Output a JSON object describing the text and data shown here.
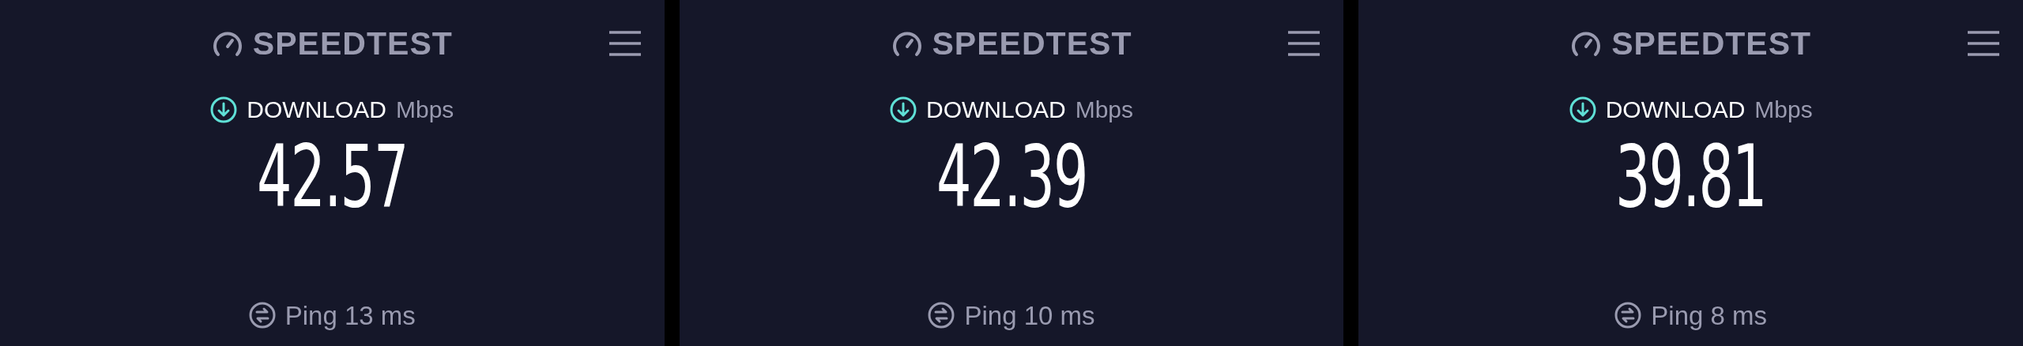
{
  "panels": [
    {
      "logo": "SPEEDTEST",
      "metric": "DOWNLOAD",
      "unit": "Mbps",
      "value": "42.57",
      "ping": "Ping 13 ms"
    },
    {
      "logo": "SPEEDTEST",
      "metric": "DOWNLOAD",
      "unit": "Mbps",
      "value": "42.39",
      "ping": "Ping 10 ms"
    },
    {
      "logo": "SPEEDTEST",
      "metric": "DOWNLOAD",
      "unit": "Mbps",
      "value": "39.81",
      "ping": "Ping 8 ms"
    }
  ]
}
